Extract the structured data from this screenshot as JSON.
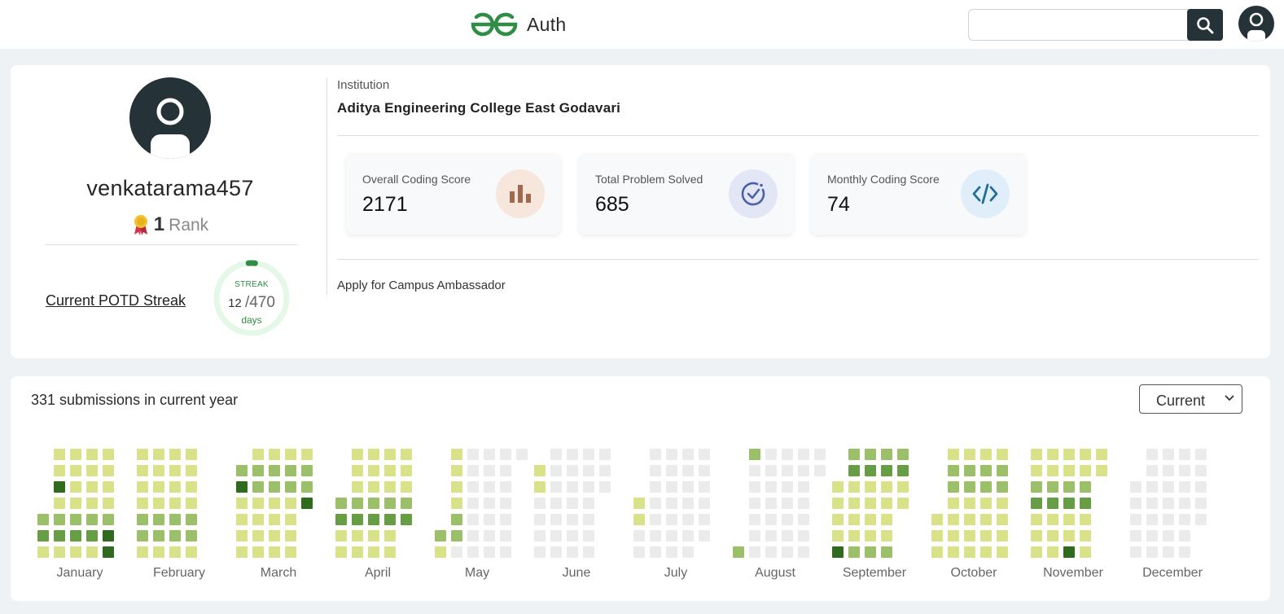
{
  "header": {
    "logo_text": "Auth",
    "search": {
      "value": "",
      "placeholder": ""
    },
    "icons": {
      "search": "search-icon",
      "avatar": "user-avatar-icon"
    }
  },
  "profile": {
    "username": "venkatarama457",
    "rank_value": "1",
    "rank_label": "Rank",
    "streak_link": "Current POTD Streak",
    "streak": {
      "label": "STREAK",
      "current": "12",
      "total": "/470",
      "unit": "days",
      "progress": 0.0255
    },
    "institution_label": "Institution",
    "institution_value": "Aditya Engineering College East Godavari",
    "stats": [
      {
        "label": "Overall Coding Score",
        "value": "2171",
        "icon": "bar-chart-icon"
      },
      {
        "label": "Total Problem Solved",
        "value": "685",
        "icon": "check-circle-icon"
      },
      {
        "label": "Monthly Coding Score",
        "value": "74",
        "icon": "code-icon"
      }
    ],
    "ambassador_link": "Apply for Campus Ambassador"
  },
  "colors": {
    "brand_green": "#2f8d46",
    "dark": "#253237",
    "heat_levels": [
      "#ebebeb",
      "#dae289",
      "#9cc069",
      "#669d45",
      "#2f6a1e"
    ]
  },
  "submissions": {
    "title": "331 submissions in current year",
    "year_select_value": "Current",
    "months": [
      "January",
      "February",
      "March",
      "April",
      "May",
      "June",
      "July",
      "August",
      "September",
      "October",
      "November",
      "December"
    ]
  }
}
